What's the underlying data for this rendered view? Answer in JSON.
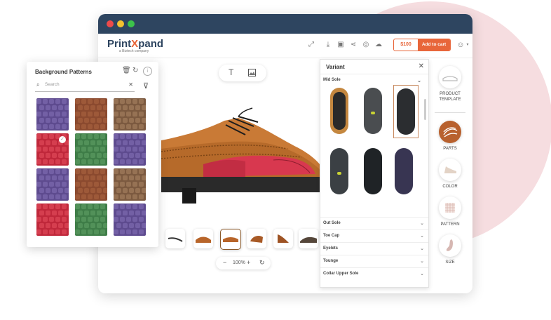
{
  "app": {
    "logo_main": "Print",
    "logo_accent": "X",
    "logo_rest": "pand",
    "logo_sub": "a Biztech company",
    "price": "$100",
    "add_to_cart": "Add to cart",
    "zoom": "100%",
    "zoom_minus": "−",
    "zoom_plus": "+"
  },
  "colors": {
    "titlebar": "#2e4560",
    "accent": "#e8663a",
    "parts_active": "#b8612e",
    "dot_red": "#ed4a4a",
    "dot_yellow": "#f5c12f",
    "dot_green": "#3cc24b"
  },
  "background_patterns": {
    "title": "Background Patterns",
    "search_placeholder": "Search",
    "icons": [
      "trash-icon",
      "refresh-icon",
      "info-icon",
      "close-icon",
      "filter-icon"
    ],
    "tiles": [
      "purple-croc",
      "brown-croc",
      "tan-croc",
      "red-croc",
      "green-croc",
      "purple-croc",
      "purple-croc",
      "brown-croc",
      "tan-croc",
      "red-croc",
      "green-croc",
      "purple-croc"
    ],
    "selected_index": 3
  },
  "variant": {
    "title": "Variant",
    "open_section": "Mid Sole",
    "sections": [
      "Out Sole",
      "Toe Cap",
      "Eyelets",
      "Tounge",
      "Collar Upper Sole"
    ]
  },
  "sidebar": {
    "items": [
      {
        "label": "PRODUCT TEMPLATE",
        "icon": "shoe-outline-icon"
      },
      {
        "label": "PARTS",
        "icon": "parts-icon",
        "active": true
      },
      {
        "label": "COLOR",
        "icon": "color-shoe-icon"
      },
      {
        "label": "PATTERN",
        "icon": "pattern-icon"
      },
      {
        "label": "SIZE",
        "icon": "size-icon"
      }
    ]
  }
}
